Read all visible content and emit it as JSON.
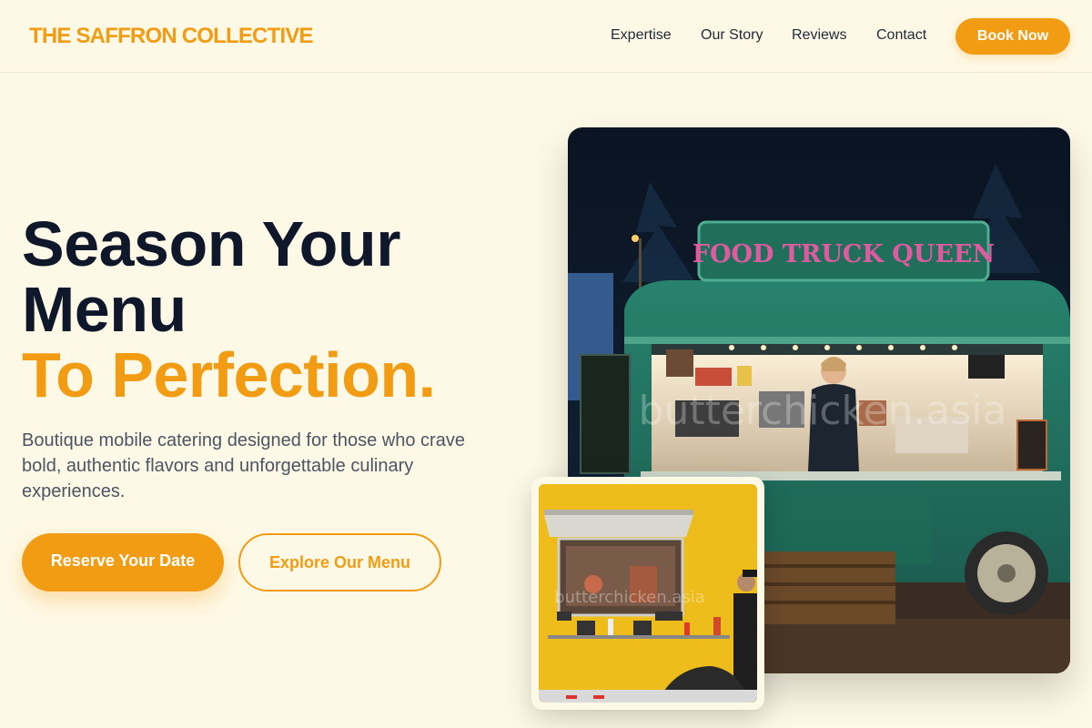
{
  "nav": {
    "brand": "THE SAFFRON COLLECTIVE",
    "links": [
      "Expertise",
      "Our Story",
      "Reviews",
      "Contact"
    ],
    "cta": "Book Now"
  },
  "hero": {
    "title_line1": "Season Your",
    "title_line2": "Menu",
    "title_accent": "To Perfection.",
    "subtitle": "Boutique mobile catering designed for those who crave bold, authentic flavors and unforgettable culinary experiences.",
    "primary_button": "Reserve Your Date",
    "secondary_button": "Explore Our Menu"
  },
  "images": {
    "main_sign": "FOOD TRUCK QUEEN",
    "main_watermark": "butterchicken.asia",
    "small_watermark": "butterchicken.asia"
  },
  "colors": {
    "accent": "#f29c13",
    "background": "#fef9e6",
    "heading": "#0f172a"
  }
}
